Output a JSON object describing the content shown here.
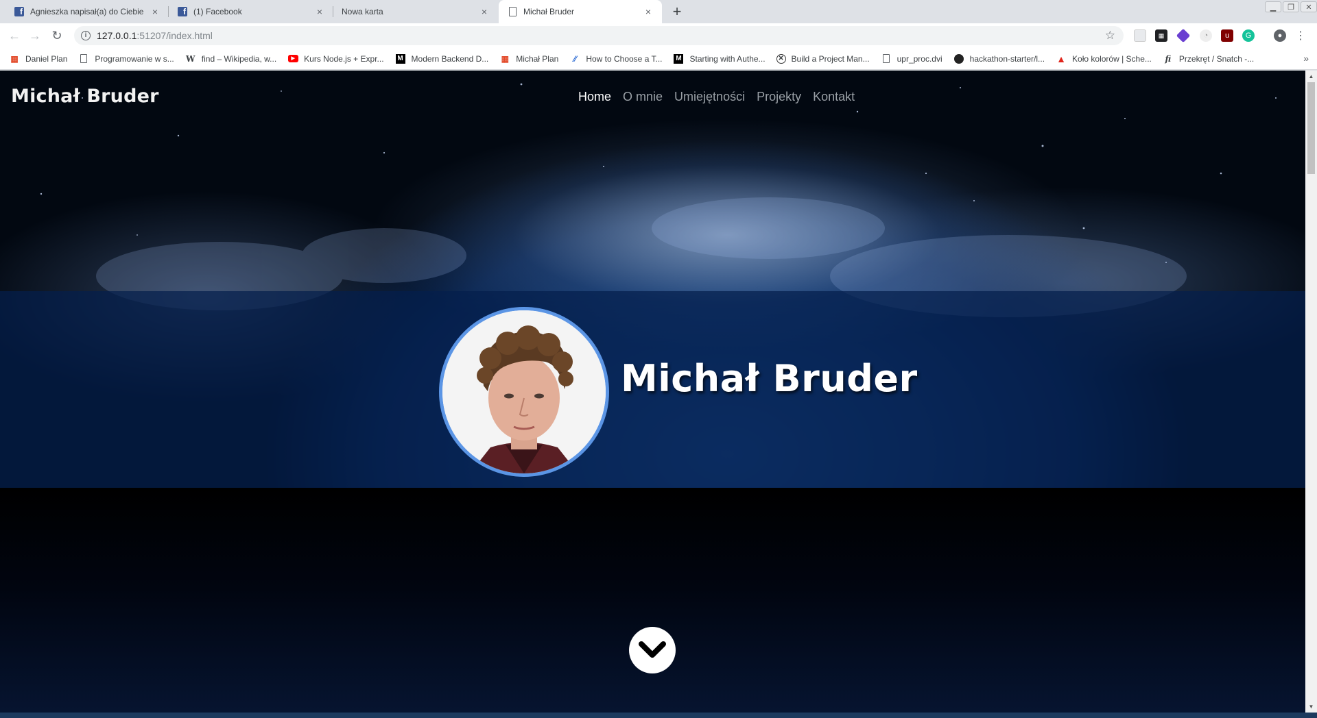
{
  "browser": {
    "tabs": [
      {
        "title": "Agnieszka napisał(a) do Ciebie",
        "icon": "facebook-icon",
        "active": false
      },
      {
        "title": "(1) Facebook",
        "icon": "facebook-icon",
        "active": false
      },
      {
        "title": "Nowa karta",
        "icon": "none",
        "active": false
      },
      {
        "title": "Michał Bruder",
        "icon": "document-icon",
        "active": true
      }
    ],
    "new_tab_symbol": "+",
    "close_symbol": "×",
    "url_host": "127.0.0.1",
    "url_rest": ":51207/index.html",
    "bookmarks": [
      {
        "label": "Daniel Plan",
        "icon": "calendar-icon"
      },
      {
        "label": "Programowanie w s...",
        "icon": "document-icon"
      },
      {
        "label": "find – Wikipedia, w...",
        "icon": "wikipedia-icon"
      },
      {
        "label": "Kurs Node.js + Expr...",
        "icon": "youtube-icon"
      },
      {
        "label": "Modern Backend D...",
        "icon": "medium-icon"
      },
      {
        "label": "Michał Plan",
        "icon": "calendar-icon"
      },
      {
        "label": "How to Choose a T...",
        "icon": "chart-icon"
      },
      {
        "label": "Starting with Authe...",
        "icon": "medium-icon"
      },
      {
        "label": "Build a Project Man...",
        "icon": "x-circle-icon"
      },
      {
        "label": "upr_proc.dvi",
        "icon": "document-icon"
      },
      {
        "label": "hackathon-starter/l...",
        "icon": "github-icon"
      },
      {
        "label": "Koło kolorów | Sche...",
        "icon": "adobe-icon"
      },
      {
        "label": "Przekręt / Snatch -...",
        "icon": "filmweb-icon"
      }
    ],
    "bookmarks_more": "»"
  },
  "site": {
    "brand": "Michał Bruder",
    "nav": [
      {
        "label": "Home",
        "active": true
      },
      {
        "label": "O mnie",
        "active": false
      },
      {
        "label": "Umiejętności",
        "active": false
      },
      {
        "label": "Projekty",
        "active": false
      },
      {
        "label": "Kontakt",
        "active": false
      }
    ],
    "hero_name": "Michał Bruder",
    "avatar_alt": "profile-photo",
    "scroll_down_icon": "chevron-down-icon"
  },
  "colors": {
    "accent": "#5b95e5",
    "nav_active": "#ffffff",
    "nav_inactive": "#9aa0a6",
    "band": "#041e4c"
  }
}
